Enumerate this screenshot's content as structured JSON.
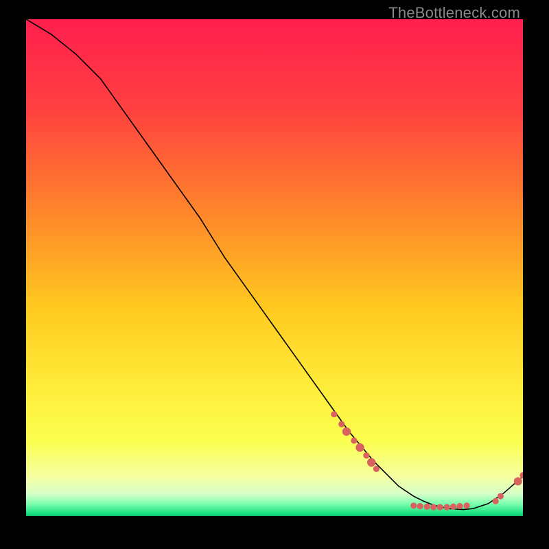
{
  "watermark": "TheBottleneck.com",
  "gradient_stops": [
    {
      "offset": 0,
      "color": "#ff1f4e"
    },
    {
      "offset": 0.18,
      "color": "#ff4040"
    },
    {
      "offset": 0.4,
      "color": "#ff8a2a"
    },
    {
      "offset": 0.58,
      "color": "#ffc91f"
    },
    {
      "offset": 0.72,
      "color": "#ffe836"
    },
    {
      "offset": 0.85,
      "color": "#fbff50"
    },
    {
      "offset": 0.92,
      "color": "#f5ffa0"
    },
    {
      "offset": 0.955,
      "color": "#d8ffc8"
    },
    {
      "offset": 0.975,
      "color": "#7dffb0"
    },
    {
      "offset": 0.995,
      "color": "#18e07e"
    },
    {
      "offset": 1,
      "color": "#10c170"
    }
  ],
  "chart_data": {
    "type": "line",
    "title": "",
    "xlabel": "",
    "ylabel": "",
    "xlim": [
      0,
      100
    ],
    "ylim": [
      0,
      100
    ],
    "series": [
      {
        "name": "curve",
        "x": [
          0,
          5,
          10,
          15,
          20,
          25,
          30,
          35,
          40,
          45,
          50,
          55,
          60,
          65,
          70,
          73,
          75,
          78,
          80,
          82,
          85,
          88,
          90,
          93,
          96,
          100
        ],
        "y": [
          100,
          97,
          93,
          88,
          81,
          74,
          67,
          60,
          52,
          45,
          38,
          31,
          24,
          17,
          11,
          8,
          6,
          4,
          3,
          2.2,
          1.5,
          1.3,
          1.5,
          2.5,
          4.5,
          8
        ]
      }
    ],
    "markers": [
      {
        "name": "cluster-a",
        "color": "#d9625f",
        "r_small": 4.6,
        "r_big": 6.2,
        "points": [
          {
            "x": 62.0,
            "y": 20.5,
            "r": "small"
          },
          {
            "x": 63.5,
            "y": 18.5,
            "r": "small"
          },
          {
            "x": 64.5,
            "y": 17.0,
            "r": "big"
          },
          {
            "x": 66.0,
            "y": 15.2,
            "r": "small"
          },
          {
            "x": 67.2,
            "y": 13.8,
            "r": "big"
          },
          {
            "x": 68.5,
            "y": 12.2,
            "r": "small"
          },
          {
            "x": 69.5,
            "y": 10.8,
            "r": "big"
          },
          {
            "x": 70.5,
            "y": 9.5,
            "r": "small"
          }
        ]
      },
      {
        "name": "cluster-b",
        "color": "#d9625f",
        "r_small": 4.6,
        "r_big": 6.0,
        "points": [
          {
            "x": 78.0,
            "y": 2.1,
            "r": "small"
          },
          {
            "x": 79.3,
            "y": 2.0,
            "r": "small"
          },
          {
            "x": 80.7,
            "y": 1.9,
            "r": "small"
          },
          {
            "x": 82.0,
            "y": 1.8,
            "r": "small"
          },
          {
            "x": 83.3,
            "y": 1.8,
            "r": "small"
          },
          {
            "x": 84.7,
            "y": 1.8,
            "r": "small"
          },
          {
            "x": 86.0,
            "y": 1.9,
            "r": "small"
          },
          {
            "x": 87.3,
            "y": 2.0,
            "r": "small"
          },
          {
            "x": 88.7,
            "y": 2.1,
            "r": "small"
          }
        ]
      },
      {
        "name": "cluster-c",
        "color": "#d9625f",
        "r_small": 4.6,
        "r_big": 6.0,
        "points": [
          {
            "x": 94.5,
            "y": 3.0,
            "r": "small"
          },
          {
            "x": 95.5,
            "y": 4.0,
            "r": "small"
          },
          {
            "x": 99.0,
            "y": 7.0,
            "r": "big"
          },
          {
            "x": 100.0,
            "y": 8.2,
            "r": "small"
          }
        ]
      }
    ]
  }
}
